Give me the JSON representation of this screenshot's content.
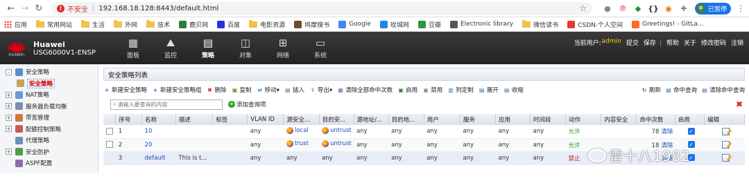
{
  "browser": {
    "insecure_label": "不安全",
    "url": "192.168.18.128:8443/default.html",
    "paused_label": "已暂停",
    "avatar_letter": "李"
  },
  "bookmarks": [
    {
      "label": "应用",
      "kind": "apps"
    },
    {
      "label": "常用网站",
      "kind": "folder"
    },
    {
      "label": "生活",
      "kind": "folder"
    },
    {
      "label": "外网",
      "kind": "folder"
    },
    {
      "label": "技术",
      "kind": "folder"
    },
    {
      "label": "鹿贝网",
      "kind": "site",
      "color": "#2e7d32"
    },
    {
      "label": "百度",
      "kind": "site",
      "color": "#2932e1"
    },
    {
      "label": "电影资源",
      "kind": "folder"
    },
    {
      "label": "鸠摩搜书",
      "kind": "site",
      "color": "#6b4e2e"
    },
    {
      "label": "Google",
      "kind": "site",
      "color": "#4285f4"
    },
    {
      "label": "玫城网",
      "kind": "site",
      "color": "#1e88e5"
    },
    {
      "label": "豆瓣",
      "kind": "site",
      "color": "#2e963d"
    },
    {
      "label": "Electronic library",
      "kind": "site",
      "color": "#555555"
    },
    {
      "label": "微信读书",
      "kind": "folder"
    },
    {
      "label": "CSDN-个人空间",
      "kind": "site",
      "color": "#e53935"
    },
    {
      "label": "Greetings! - GitLa...",
      "kind": "site",
      "color": "#fc6d26"
    }
  ],
  "app": {
    "brand_line1": "Huawei",
    "brand_line2": "USG6000V1-ENSP",
    "logo_word": "HUAWEI",
    "nav": [
      {
        "label": "面板",
        "icon": "dashboard-icon"
      },
      {
        "label": "监控",
        "icon": "monitor-icon"
      },
      {
        "label": "策略",
        "icon": "policy-icon",
        "active": true
      },
      {
        "label": "对象",
        "icon": "object-icon"
      },
      {
        "label": "网络",
        "icon": "network-icon"
      },
      {
        "label": "系统",
        "icon": "system-icon"
      }
    ],
    "current_user_label": "当前用户:",
    "current_user": "admin",
    "actions": [
      "提交",
      "保存",
      "帮助",
      "关于",
      "修改密码",
      "注销"
    ]
  },
  "sidebar": [
    {
      "label": "安全策略",
      "expander": "-",
      "child": false,
      "color": "#5b8bd0"
    },
    {
      "label": "安全策略",
      "expander": "",
      "child": true,
      "selected": true,
      "color": "#c6a25a"
    },
    {
      "label": "NAT策略",
      "expander": "+",
      "child": false,
      "color": "#6b9ad8"
    },
    {
      "label": "服务器负载均衡",
      "expander": "+",
      "child": false,
      "color": "#7a8fb0"
    },
    {
      "label": "带宽管理",
      "expander": "+",
      "child": false,
      "color": "#d07a3a"
    },
    {
      "label": "配额控制策略",
      "expander": "+",
      "child": false,
      "color": "#c75a5a"
    },
    {
      "label": "代理策略",
      "expander": "",
      "child": false,
      "color": "#6f8fb8"
    },
    {
      "label": "安全防护",
      "expander": "+",
      "child": false,
      "color": "#4f9a4f"
    },
    {
      "label": "ASPF配置",
      "expander": "",
      "child": false,
      "color": "#8a6db0"
    }
  ],
  "panel": {
    "title": "安全策略列表",
    "toolbar": [
      {
        "label": "新建安全策略",
        "icon": "add-icon",
        "color": "#1a73e8",
        "glyph": "+"
      },
      {
        "label": "新建安全策略组",
        "icon": "add-group-icon",
        "color": "#1a73e8",
        "glyph": "+"
      },
      {
        "label": "删除",
        "icon": "delete-icon",
        "color": "#d22",
        "glyph": "✖"
      },
      {
        "label": "复制",
        "icon": "copy-icon",
        "color": "#a07a20",
        "glyph": "▣"
      },
      {
        "label": "移动▾",
        "icon": "move-icon",
        "color": "#2c7be5",
        "glyph": "⇄"
      },
      {
        "label": "插入",
        "icon": "insert-icon",
        "color": "#3b6fb0",
        "glyph": "▤"
      },
      {
        "label": "导出▾",
        "icon": "export-icon",
        "color": "#c07a20",
        "glyph": "⇪"
      },
      {
        "label": "清除全部命中次数",
        "icon": "clear-hits-icon",
        "color": "#8a5db5",
        "glyph": "▦"
      },
      {
        "label": "启用",
        "icon": "enable-icon",
        "color": "#2a8a2a",
        "glyph": "▣"
      },
      {
        "label": "禁用",
        "icon": "disable-icon",
        "color": "#8a8a8a",
        "glyph": "▣"
      },
      {
        "label": "列定制",
        "icon": "columns-icon",
        "color": "#3b6fb0",
        "glyph": "▥"
      },
      {
        "label": "展开",
        "icon": "expand-icon",
        "color": "#3b6fb0",
        "glyph": "▤"
      },
      {
        "label": "收缩",
        "icon": "collapse-icon",
        "color": "#3b6fb0",
        "glyph": "▤"
      }
    ],
    "toolbar_right": [
      {
        "label": "刷新",
        "icon": "refresh-icon",
        "color": "#2a8a2a",
        "glyph": "↻"
      },
      {
        "label": "命中查询",
        "icon": "hit-query-icon",
        "color": "#3b6fb0",
        "glyph": "▤"
      },
      {
        "label": "清除命中查询",
        "icon": "clear-query-icon",
        "color": "#3b6fb0",
        "glyph": "▤"
      }
    ],
    "search_placeholder": "请输入要查询的内容",
    "add_query": "添加查询项"
  },
  "table": {
    "headers": [
      "序号",
      "名称",
      "描述",
      "标签",
      "VLAN ID",
      "源安全...",
      "目的安...",
      "源地址/...",
      "目的地...",
      "用户",
      "服务",
      "应用",
      "时间段",
      "动作",
      "内容安全",
      "命中次数",
      "启用",
      "编辑"
    ],
    "rows": [
      {
        "idx": "1",
        "name": "10",
        "desc": "",
        "tag": "",
        "vlan": "any",
        "src_zone": "local",
        "dst_zone": "untrust",
        "src_addr": "any",
        "dst_addr": "any",
        "user": "any",
        "service": "any",
        "app": "any",
        "time": "any",
        "action": "允许",
        "action_type": "allow",
        "content": "",
        "hits": "78",
        "clear": "清除",
        "enabled": true
      },
      {
        "idx": "2",
        "name": "20",
        "desc": "",
        "tag": "",
        "vlan": "any",
        "src_zone": "trust",
        "dst_zone": "untrust",
        "src_addr": "any",
        "dst_addr": "any",
        "user": "any",
        "service": "any",
        "app": "any",
        "time": "any",
        "action": "允许",
        "action_type": "allow",
        "content": "",
        "hits": "18",
        "clear": "清除",
        "enabled": true
      },
      {
        "idx": "3",
        "name": "default",
        "desc": "This is t...",
        "tag": "",
        "vlan": "any",
        "src_zone": "any",
        "dst_zone": "any",
        "src_addr": "any",
        "dst_addr": "any",
        "user": "any",
        "service": "any",
        "app": "any",
        "time": "any",
        "action": "禁止",
        "action_type": "deny",
        "content": "",
        "hits": "",
        "clear": "清除",
        "enabled": true
      }
    ]
  },
  "watermark": "雷十八1982"
}
